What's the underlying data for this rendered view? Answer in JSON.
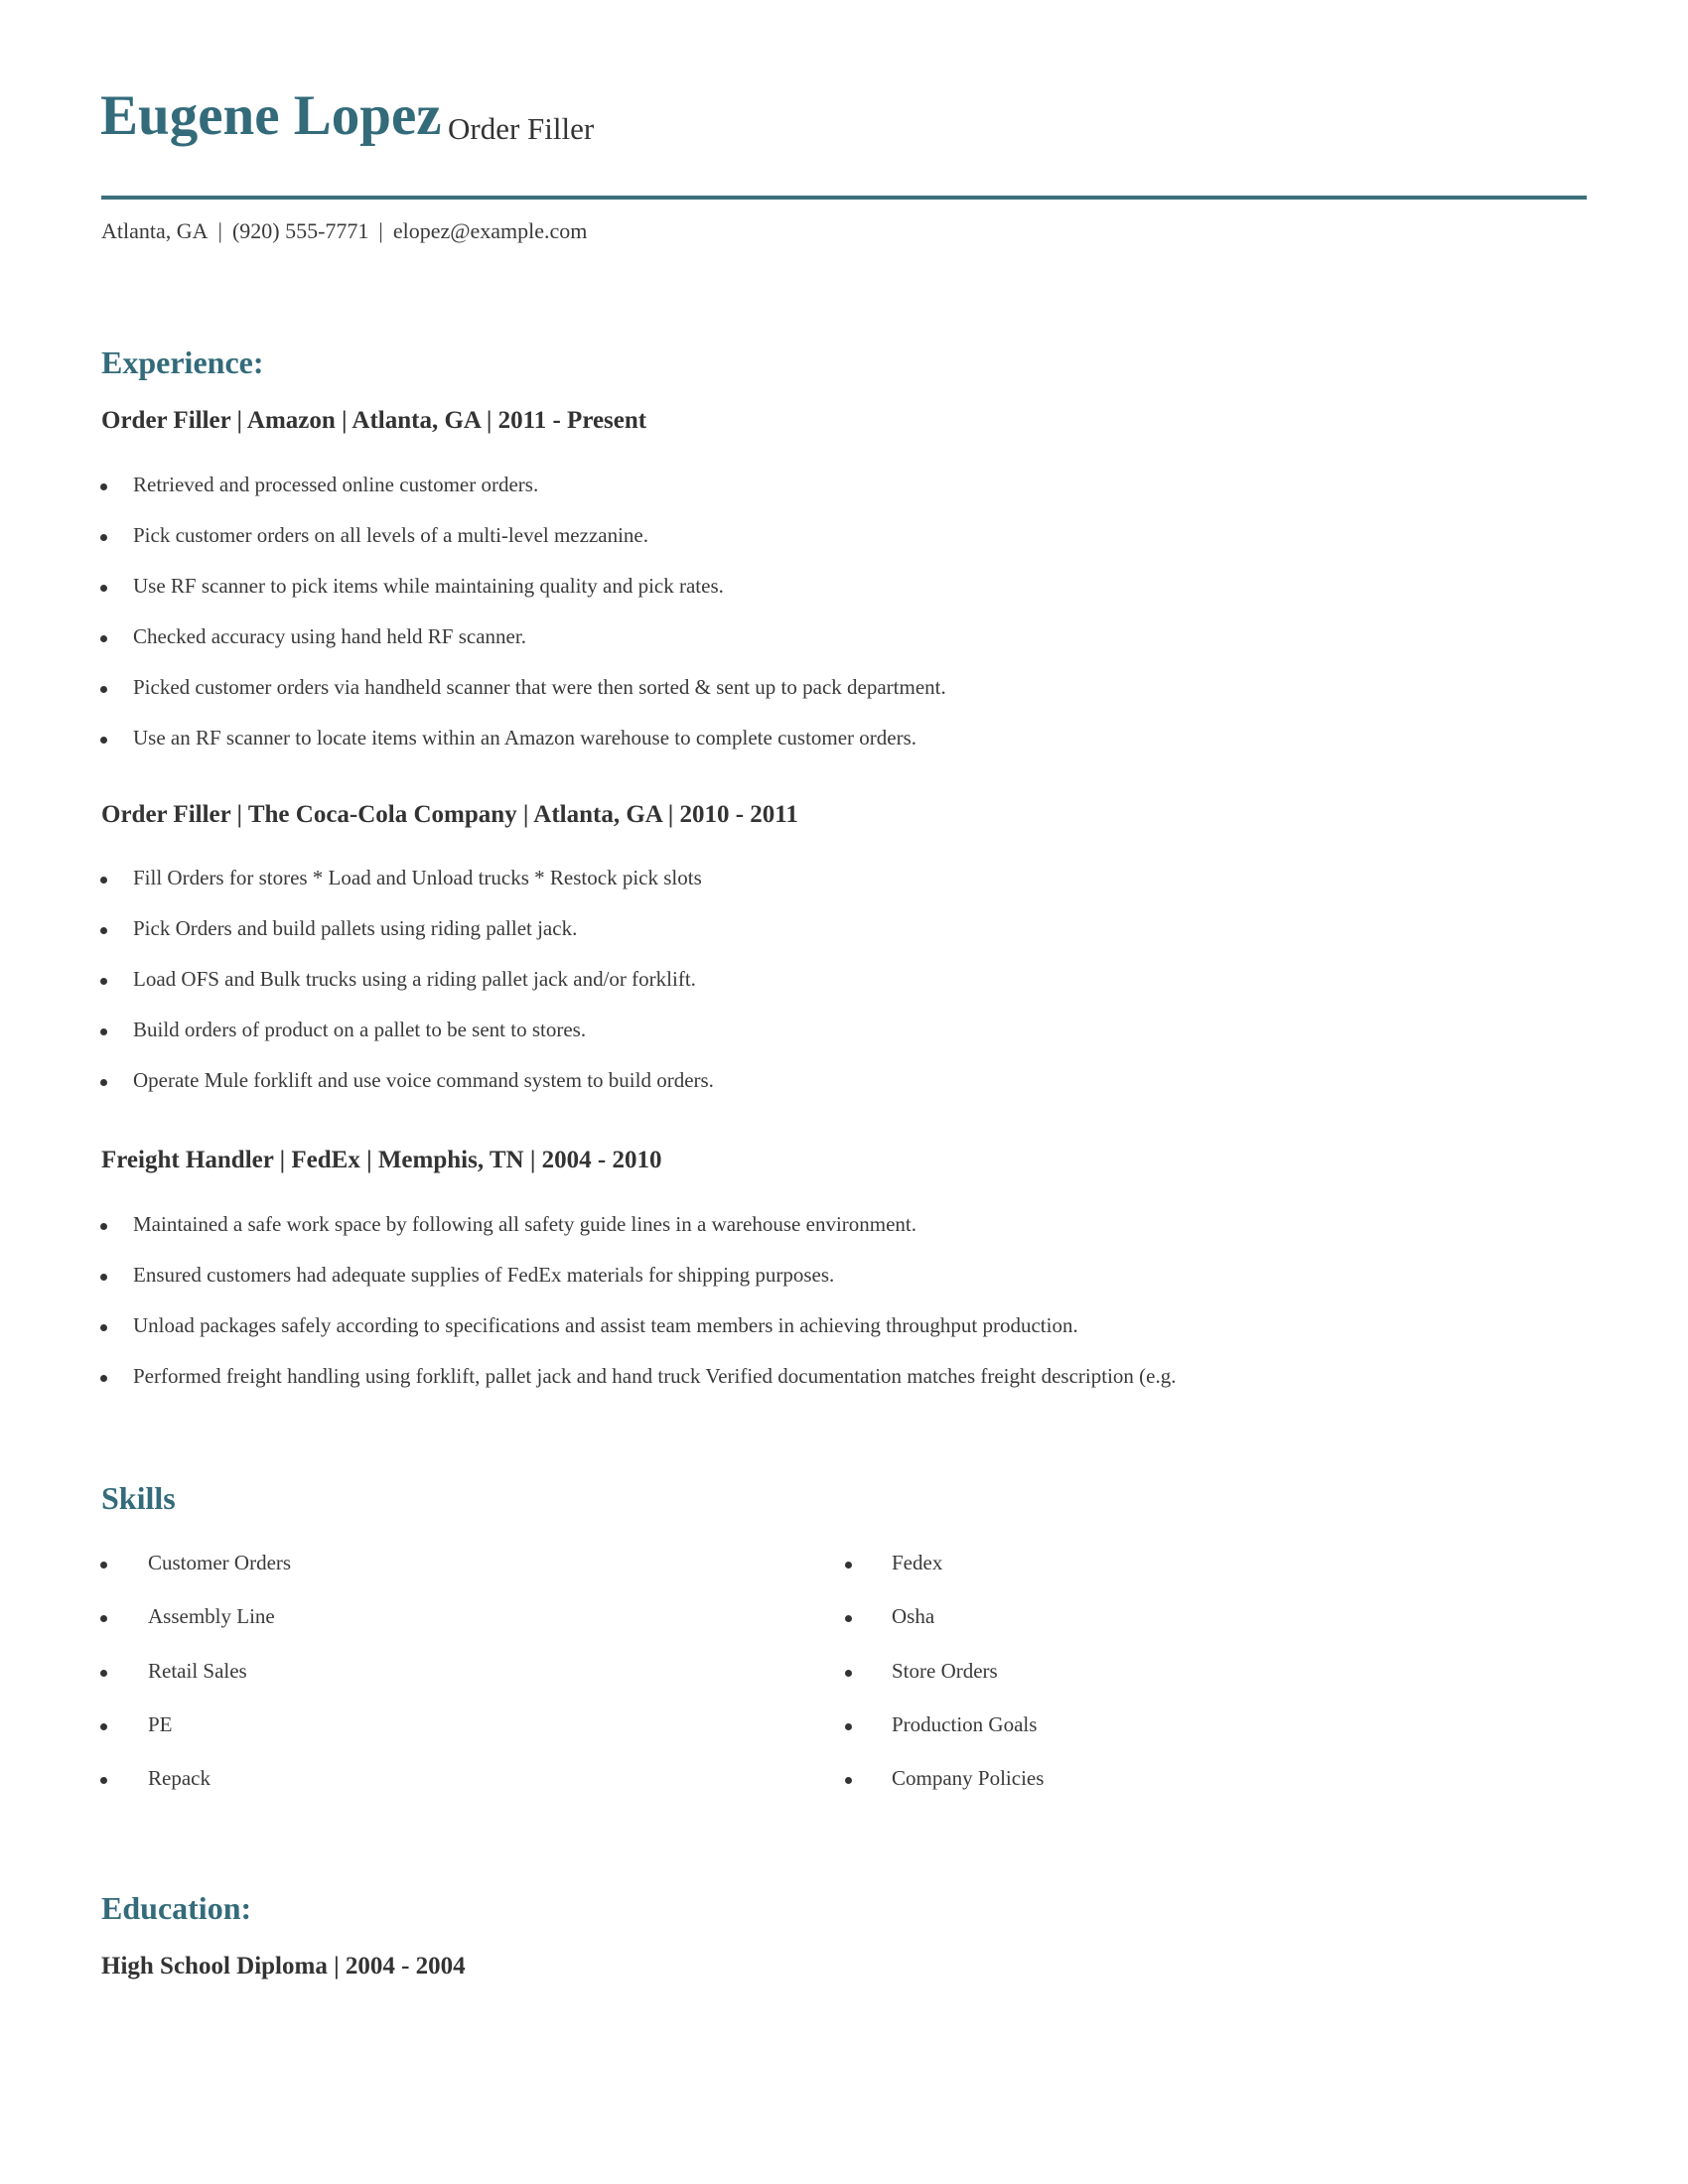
{
  "header": {
    "name": "Eugene Lopez",
    "headline": "Order Filler",
    "contact": {
      "location": "Atlanta, GA",
      "phone": "(920) 555-7771",
      "email": "elopez@example.com",
      "separator": "|"
    }
  },
  "experience": {
    "title": "Experience:",
    "jobs": [
      {
        "heading": "Order Filler | Amazon | Atlanta, GA |  2011 - Present",
        "bullets": [
          "Retrieved and processed online customer orders.",
          "Pick customer orders on all levels of a multi-level mezzanine.",
          "Use RF scanner to pick items while maintaining quality and pick rates.",
          "Checked accuracy using hand held RF scanner.",
          "Picked customer orders via handheld scanner that were then sorted & sent up to pack department.",
          "Use an RF scanner to locate items within an Amazon warehouse to complete customer orders."
        ]
      },
      {
        "heading": "Order Filler | The Coca-Cola Company | Atlanta, GA |  2010 - 2011",
        "bullets": [
          "Fill Orders for stores * Load and Unload trucks * Restock pick slots",
          "Pick Orders and build pallets using riding pallet jack.",
          "Load OFS and Bulk trucks using a riding pallet jack and/or forklift.",
          "Build orders of product on a pallet to be sent to stores.",
          "Operate Mule forklift and use voice command system to build orders."
        ]
      },
      {
        "heading": "Freight Handler | FedEx | Memphis, TN |  2004 - 2010",
        "bullets": [
          "Maintained a safe work space by following all safety guide lines in a warehouse environment.",
          "Ensured customers had adequate supplies of FedEx materials for shipping purposes.",
          "Unload packages safely according to specifications and assist team members in achieving throughput production.",
          "Performed freight handling using forklift, pallet jack and hand truck Verified documentation matches freight description (e.g."
        ]
      }
    ]
  },
  "skills": {
    "title": "Skills",
    "left": [
      "Customer Orders",
      "Assembly Line",
      "Retail Sales",
      "PE",
      "Repack"
    ],
    "right": [
      "Fedex",
      "Osha",
      "Store Orders",
      "Production Goals",
      "Company Policies"
    ]
  },
  "education": {
    "title": "Education:",
    "entries": [
      {
        "heading": "High School Diploma |  2004 - 2004"
      }
    ]
  },
  "colors": {
    "accent": "#336b7a",
    "text": "#333333"
  }
}
